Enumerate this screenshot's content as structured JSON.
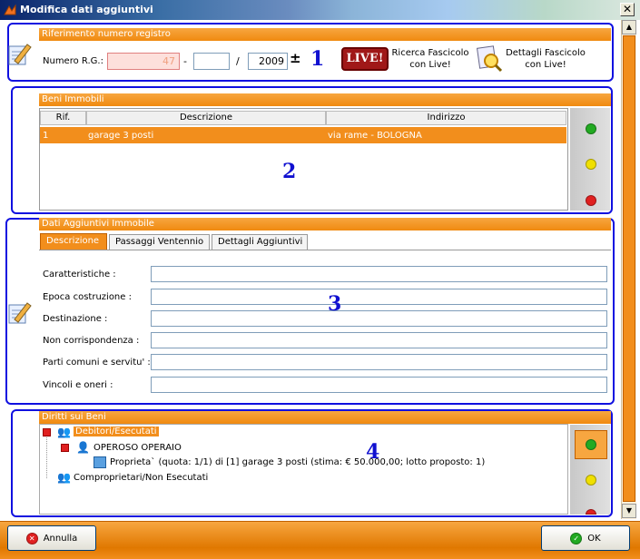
{
  "window": {
    "title": "Modifica dati aggiuntivi",
    "close_glyph": "✕"
  },
  "section1": {
    "header": "Riferimento numero registro",
    "rg_label": "Numero R.G.:",
    "rg_number": "47",
    "dash": "-",
    "rg_suffix": "",
    "slash": "/",
    "rg_year": "2009",
    "plusminus": "±",
    "live_badge": "LIVE!",
    "ricerca_label": "Ricerca Fascicolo con Live!",
    "dettagli_label": "Dettagli Fascicolo con Live!",
    "annotation": "1"
  },
  "section2": {
    "header": "Beni Immobili",
    "columns": [
      "Rif.",
      "Descrizione",
      "Indirizzo"
    ],
    "rows": [
      {
        "rif": "1",
        "descrizione": "garage 3 posti",
        "indirizzo": "via rame - BOLOGNA"
      }
    ],
    "annotation": "2"
  },
  "section3": {
    "header": "Dati Aggiuntivi Immobile",
    "tabs": [
      "Descrizione",
      "Passaggi Ventennio",
      "Dettagli Aggiuntivi"
    ],
    "fields": [
      {
        "label": "Caratteristiche :",
        "value": ""
      },
      {
        "label": "Epoca costruzione :",
        "value": ""
      },
      {
        "label": "Destinazione :",
        "value": ""
      },
      {
        "label": "Non corrispondenza :",
        "value": ""
      },
      {
        "label": "Parti comuni e servitu' :",
        "value": ""
      },
      {
        "label": "Vincoli e oneri :",
        "value": ""
      }
    ],
    "annotation": "3"
  },
  "section4": {
    "header": "Diritti sui Beni",
    "tree": {
      "debitori": "Debitori/Esecutati",
      "person": "OPEROSO OPERAIO",
      "diritto": "Proprieta` (quota: 1/1)  di  [1] garage 3 posti (stima: € 50.000,00; lotto proposto: 1)",
      "comproprietari": "Comproprietari/Non Esecutati"
    },
    "annotation": "4"
  },
  "footer": {
    "cancel_label": "Annulla",
    "ok_label": "OK"
  },
  "colors": {
    "accent": "#f28e1c",
    "annotation_blue": "#1010e0",
    "add_green": "#22aa22",
    "edit_yellow": "#f0e000",
    "remove_red": "#e02020"
  }
}
